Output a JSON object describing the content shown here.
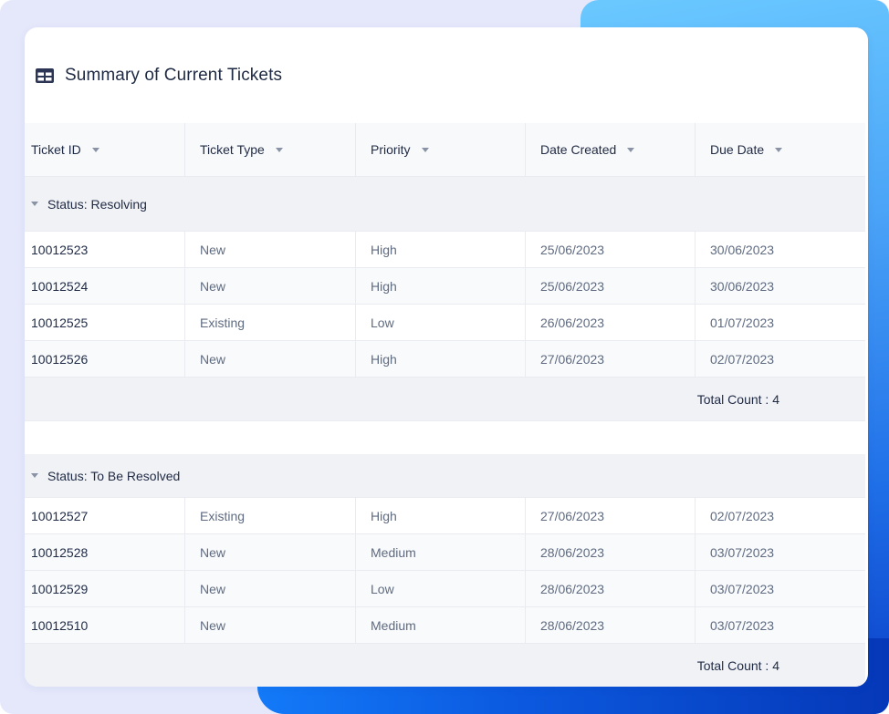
{
  "title": "Summary of Current Tickets",
  "title_icon": "table-icon",
  "colors": {
    "page_bg": "#e5e8fb",
    "accent_blue": "#1f6fe8",
    "text_primary": "#1f2a44",
    "text_secondary": "#5f6b80"
  },
  "columns": [
    {
      "label": "Ticket ID",
      "icon": "sort-caret-icon"
    },
    {
      "label": "Ticket Type",
      "icon": "sort-caret-icon"
    },
    {
      "label": "Priority",
      "icon": "sort-caret-icon"
    },
    {
      "label": "Date Created",
      "icon": "sort-caret-icon"
    },
    {
      "label": "Due Date",
      "icon": "sort-caret-icon"
    }
  ],
  "groups": [
    {
      "label": "Status: Resolving",
      "rows": [
        [
          "10012523",
          "New",
          "High",
          "25/06/2023",
          "30/06/2023"
        ],
        [
          "10012524",
          "New",
          "High",
          "25/06/2023",
          "30/06/2023"
        ],
        [
          "10012525",
          "Existing",
          "Low",
          "26/06/2023",
          "01/07/2023"
        ],
        [
          "10012526",
          "New",
          "High",
          "27/06/2023",
          "02/07/2023"
        ]
      ],
      "total_label": "Total Count : 4"
    },
    {
      "label": "Status:  To Be Resolved",
      "rows": [
        [
          "10012527",
          "Existing",
          "High",
          "27/06/2023",
          "02/07/2023"
        ],
        [
          "10012528",
          "New",
          "Medium",
          "28/06/2023",
          "03/07/2023"
        ],
        [
          "10012529",
          "New",
          "Low",
          "28/06/2023",
          "03/07/2023"
        ],
        [
          "10012510",
          "New",
          "Medium",
          "28/06/2023",
          "03/07/2023"
        ]
      ],
      "total_label": "Total Count : 4"
    }
  ]
}
